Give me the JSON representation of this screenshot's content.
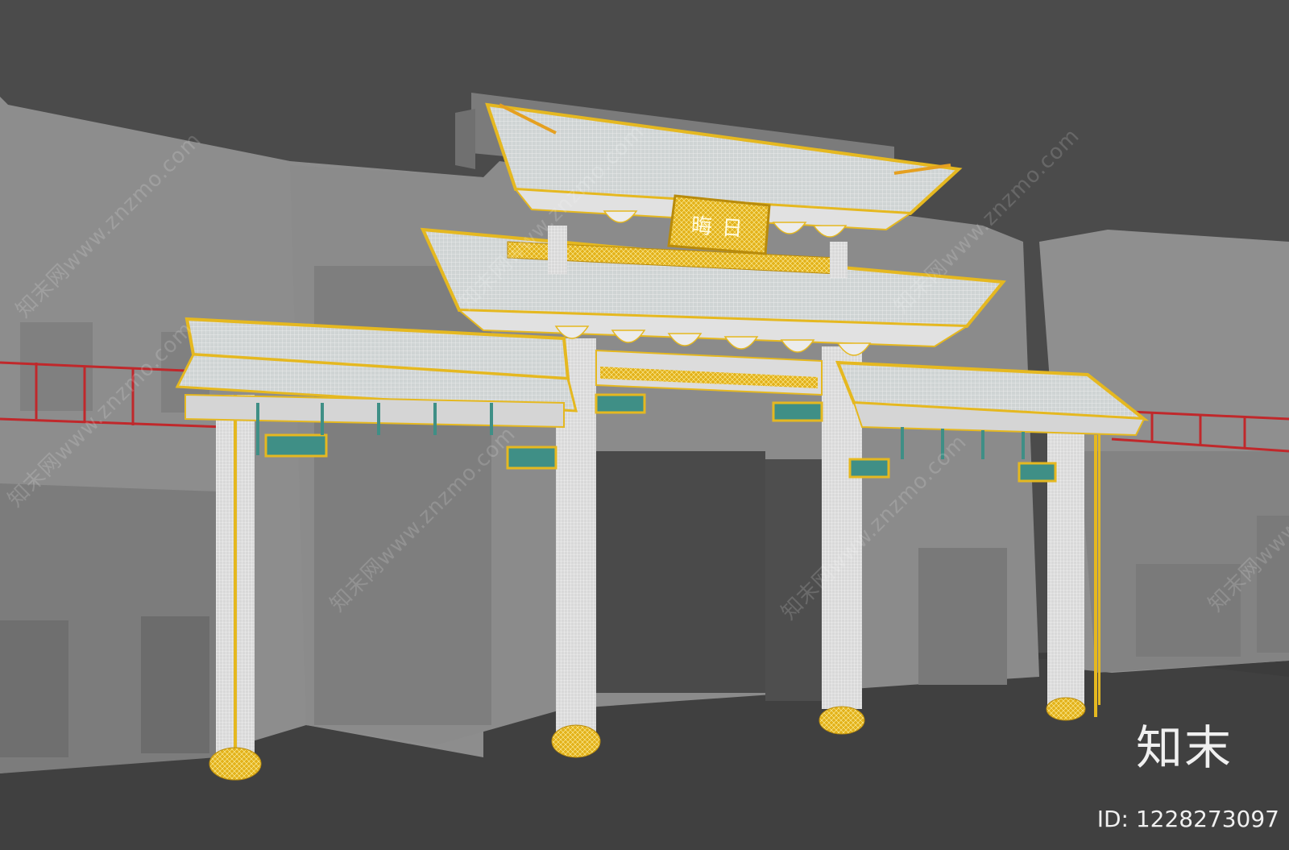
{
  "scene": {
    "subject": "3d-rendered-paifang-gateway",
    "colors": {
      "sky": "#4a4a4a",
      "ground": "#3b3b3b",
      "building": "#8e8e8e",
      "building_dark": "#7a7a7a",
      "wireframe": "#e8e8e8",
      "gold": "#e5b820",
      "teal": "#3f8f86",
      "red_rail": "#c0282b"
    },
    "plaque_text": "晦日"
  },
  "watermark": {
    "diagonal_text": "知末网www.znzmo.com",
    "logo_text": "知末",
    "id_text": "ID: 1228273097"
  }
}
